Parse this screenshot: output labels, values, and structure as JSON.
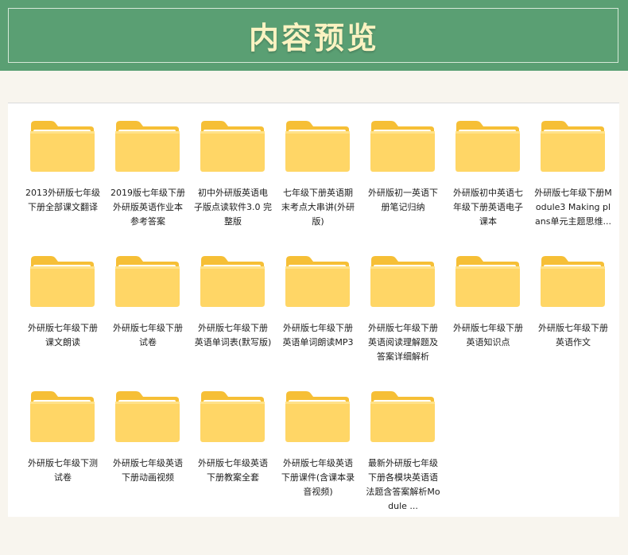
{
  "header": {
    "title": "内容预览"
  },
  "files": [
    {
      "name": "2013外研版七年级下册全部课文翻译"
    },
    {
      "name": "2019版七年级下册外研版英语作业本参考答案"
    },
    {
      "name": "初中外研版英语电子版点读软件3.0 完整版"
    },
    {
      "name": "七年级下册英语期末考点大串讲(外研版)"
    },
    {
      "name": "外研版初一英语下册笔记归纳"
    },
    {
      "name": "外研版初中英语七年级下册英语电子课本"
    },
    {
      "name": "外研版七年级下册Module3 Making plans单元主题思维..."
    },
    {
      "name": "外研版七年级下册课文朗读"
    },
    {
      "name": "外研版七年级下册试卷"
    },
    {
      "name": "外研版七年级下册英语单词表(默写版)"
    },
    {
      "name": "外研版七年级下册英语单词朗读MP3"
    },
    {
      "name": "外研版七年级下册英语阅读理解题及答案详细解析"
    },
    {
      "name": "外研版七年级下册英语知识点"
    },
    {
      "name": "外研版七年级下册英语作文"
    },
    {
      "name": "外研版七年级下测试卷"
    },
    {
      "name": "外研版七年级英语下册动画视频"
    },
    {
      "name": "外研版七年级英语下册教案全套"
    },
    {
      "name": "外研版七年级英语下册课件(含课本录音视频)"
    },
    {
      "name": "最新外研版七年级下册各模块英语语法题含答案解析Module ..."
    }
  ],
  "icon": {
    "name": "folder-icon",
    "color_back": "#f7c340",
    "color_front": "#ffd96b",
    "color_paper": "#ffffff"
  }
}
